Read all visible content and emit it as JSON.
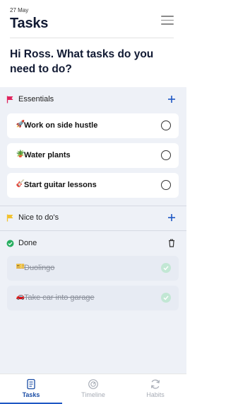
{
  "header": {
    "date": "27 May",
    "title": "Tasks",
    "greeting": "Hi Ross. What tasks do you need to do?"
  },
  "sections": {
    "essentials": {
      "label": "Essentials",
      "flag_color": "#e0245e",
      "action_icon": "plus-icon",
      "tasks": [
        {
          "emoji": "🚀",
          "label": "Work on side hustle",
          "done": false
        },
        {
          "emoji": "🪴",
          "label": "Water plants",
          "done": false
        },
        {
          "emoji": "🎸",
          "label": "Start guitar lessons",
          "done": false
        }
      ]
    },
    "nice_to_dos": {
      "label": "Nice to do's",
      "flag_color": "#f2c230",
      "action_icon": "plus-icon"
    },
    "done": {
      "label": "Done",
      "status_color": "#27ae60",
      "action_icon": "trash-icon",
      "tasks": [
        {
          "emoji": "🎫",
          "label": "Duolingo",
          "done": true
        },
        {
          "emoji": "🚗",
          "label": "Take car into garage",
          "done": true
        }
      ]
    }
  },
  "tabs": [
    {
      "label": "Tasks",
      "icon": "tasks-icon",
      "active": true
    },
    {
      "label": "Timeline",
      "icon": "timeline-icon",
      "active": false
    },
    {
      "label": "Habits",
      "icon": "habits-icon",
      "active": false
    }
  ],
  "colors": {
    "accent": "#1f58c4",
    "background": "#eef1f7",
    "done_check": "#c2e7d4"
  }
}
